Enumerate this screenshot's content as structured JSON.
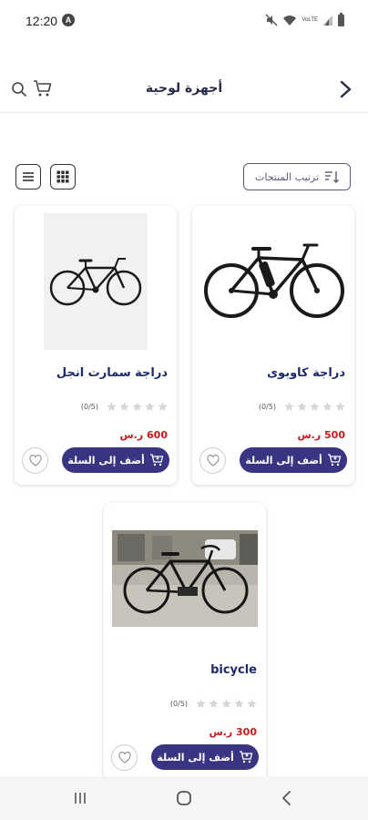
{
  "status_bar": {
    "time": "12:20",
    "notification_badge": "A",
    "volte_label": "VoLTE",
    "icons": [
      "mute-icon",
      "wifi-icon",
      "signal-icon",
      "battery-icon"
    ]
  },
  "header": {
    "title": "أجهزة لوحية",
    "icons": [
      "back-chevron-icon",
      "search-icon",
      "cart-icon"
    ]
  },
  "toolbar": {
    "sort_label": "ترتيب المنتجات",
    "icons": [
      "sort-icon",
      "list-view-icon",
      "grid-view-icon"
    ]
  },
  "products": [
    {
      "name": "دراجة كاوبوى",
      "rating_text": "(0/5)",
      "stars": 0,
      "price": "500 ر.س",
      "add_label": "أضف إلى السلة"
    },
    {
      "name": "دراجة سمارت انجل",
      "rating_text": "(0/5)",
      "stars": 0,
      "price": "600 ر.س",
      "add_label": "أضف إلى السلة"
    },
    {
      "name": "bicycle",
      "rating_text": "(0/5)",
      "stars": 0,
      "price": "300 ر.س",
      "add_label": "أضف إلى السلة"
    }
  ],
  "colors": {
    "primary": "#3a3582",
    "title_text": "#1f2a6b",
    "price": "#c41a1a",
    "star_empty": "#d6d6d6"
  },
  "navbar": {
    "icons": [
      "recent-apps-icon",
      "home-icon",
      "nav-back-icon"
    ]
  }
}
